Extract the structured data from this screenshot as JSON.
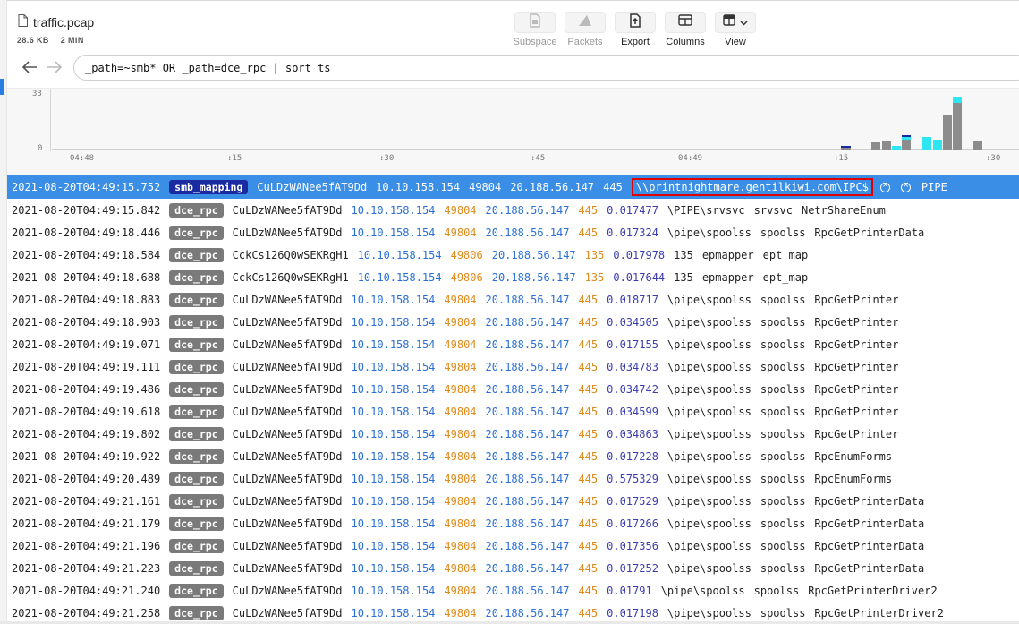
{
  "file": {
    "name": "traffic.pcap",
    "size": "28.6 KB",
    "duration": "2 MIN",
    "icon": "file-icon"
  },
  "toolbar": {
    "subspace": "Subspace",
    "packets": "Packets",
    "export": "Export",
    "columns": "Columns",
    "view": "View"
  },
  "query": "_path=~smb* OR _path=dce_rpc | sort ts",
  "histogram": {
    "y_labels": [
      "33",
      "0"
    ],
    "x_labels": [
      "04:48",
      ":15",
      ":30",
      ":45",
      "04:49",
      ":15",
      ":30"
    ],
    "colors": {
      "smb_mapping": "#1a2aa0",
      "dce_rpc": "#8c8c8c",
      "other": "#2ee6f0"
    }
  },
  "selected_row": {
    "ts": "2021-08-20T04:49:15.752",
    "path": "smb_mapping",
    "uid": "CuLDzWANee5fAT9Dd",
    "orig_h": "10.10.158.154",
    "orig_p": "49804",
    "resp_h": "20.188.56.147",
    "resp_p": "445",
    "share_path": "\\\\printnightmare.gentilkiwi.com\\IPC$",
    "service": "PIPE"
  },
  "rows": [
    {
      "ts": "2021-08-20T04:49:15.842",
      "path": "dce_rpc",
      "uid": "CuLDzWANee5fAT9Dd",
      "orig_h": "10.10.158.154",
      "orig_p": "49804",
      "resp_h": "20.188.56.147",
      "resp_p": "445",
      "rtt": "0.017477",
      "named_pipe": "\\PIPE\\srvsvc",
      "endpoint": "srvsvc",
      "operation": "NetrShareEnum"
    },
    {
      "ts": "2021-08-20T04:49:18.446",
      "path": "dce_rpc",
      "uid": "CuLDzWANee5fAT9Dd",
      "orig_h": "10.10.158.154",
      "orig_p": "49804",
      "resp_h": "20.188.56.147",
      "resp_p": "445",
      "rtt": "0.017324",
      "named_pipe": "\\pipe\\spoolss",
      "endpoint": "spoolss",
      "operation": "RpcGetPrinterData"
    },
    {
      "ts": "2021-08-20T04:49:18.584",
      "path": "dce_rpc",
      "uid": "CckCs126Q0wSEKRgH1",
      "orig_h": "10.10.158.154",
      "orig_p": "49806",
      "resp_h": "20.188.56.147",
      "resp_p": "135",
      "rtt": "0.017978",
      "named_pipe": "135",
      "endpoint": "epmapper",
      "operation": "ept_map"
    },
    {
      "ts": "2021-08-20T04:49:18.688",
      "path": "dce_rpc",
      "uid": "CckCs126Q0wSEKRgH1",
      "orig_h": "10.10.158.154",
      "orig_p": "49806",
      "resp_h": "20.188.56.147",
      "resp_p": "135",
      "rtt": "0.017644",
      "named_pipe": "135",
      "endpoint": "epmapper",
      "operation": "ept_map"
    },
    {
      "ts": "2021-08-20T04:49:18.883",
      "path": "dce_rpc",
      "uid": "CuLDzWANee5fAT9Dd",
      "orig_h": "10.10.158.154",
      "orig_p": "49804",
      "resp_h": "20.188.56.147",
      "resp_p": "445",
      "rtt": "0.018717",
      "named_pipe": "\\pipe\\spoolss",
      "endpoint": "spoolss",
      "operation": "RpcGetPrinter"
    },
    {
      "ts": "2021-08-20T04:49:18.903",
      "path": "dce_rpc",
      "uid": "CuLDzWANee5fAT9Dd",
      "orig_h": "10.10.158.154",
      "orig_p": "49804",
      "resp_h": "20.188.56.147",
      "resp_p": "445",
      "rtt": "0.034505",
      "named_pipe": "\\pipe\\spoolss",
      "endpoint": "spoolss",
      "operation": "RpcGetPrinter"
    },
    {
      "ts": "2021-08-20T04:49:19.071",
      "path": "dce_rpc",
      "uid": "CuLDzWANee5fAT9Dd",
      "orig_h": "10.10.158.154",
      "orig_p": "49804",
      "resp_h": "20.188.56.147",
      "resp_p": "445",
      "rtt": "0.017155",
      "named_pipe": "\\pipe\\spoolss",
      "endpoint": "spoolss",
      "operation": "RpcGetPrinter"
    },
    {
      "ts": "2021-08-20T04:49:19.111",
      "path": "dce_rpc",
      "uid": "CuLDzWANee5fAT9Dd",
      "orig_h": "10.10.158.154",
      "orig_p": "49804",
      "resp_h": "20.188.56.147",
      "resp_p": "445",
      "rtt": "0.034783",
      "named_pipe": "\\pipe\\spoolss",
      "endpoint": "spoolss",
      "operation": "RpcGetPrinter"
    },
    {
      "ts": "2021-08-20T04:49:19.486",
      "path": "dce_rpc",
      "uid": "CuLDzWANee5fAT9Dd",
      "orig_h": "10.10.158.154",
      "orig_p": "49804",
      "resp_h": "20.188.56.147",
      "resp_p": "445",
      "rtt": "0.034742",
      "named_pipe": "\\pipe\\spoolss",
      "endpoint": "spoolss",
      "operation": "RpcGetPrinter"
    },
    {
      "ts": "2021-08-20T04:49:19.618",
      "path": "dce_rpc",
      "uid": "CuLDzWANee5fAT9Dd",
      "orig_h": "10.10.158.154",
      "orig_p": "49804",
      "resp_h": "20.188.56.147",
      "resp_p": "445",
      "rtt": "0.034599",
      "named_pipe": "\\pipe\\spoolss",
      "endpoint": "spoolss",
      "operation": "RpcGetPrinter"
    },
    {
      "ts": "2021-08-20T04:49:19.802",
      "path": "dce_rpc",
      "uid": "CuLDzWANee5fAT9Dd",
      "orig_h": "10.10.158.154",
      "orig_p": "49804",
      "resp_h": "20.188.56.147",
      "resp_p": "445",
      "rtt": "0.034863",
      "named_pipe": "\\pipe\\spoolss",
      "endpoint": "spoolss",
      "operation": "RpcGetPrinter"
    },
    {
      "ts": "2021-08-20T04:49:19.922",
      "path": "dce_rpc",
      "uid": "CuLDzWANee5fAT9Dd",
      "orig_h": "10.10.158.154",
      "orig_p": "49804",
      "resp_h": "20.188.56.147",
      "resp_p": "445",
      "rtt": "0.017228",
      "named_pipe": "\\pipe\\spoolss",
      "endpoint": "spoolss",
      "operation": "RpcEnumForms"
    },
    {
      "ts": "2021-08-20T04:49:20.489",
      "path": "dce_rpc",
      "uid": "CuLDzWANee5fAT9Dd",
      "orig_h": "10.10.158.154",
      "orig_p": "49804",
      "resp_h": "20.188.56.147",
      "resp_p": "445",
      "rtt": "0.575329",
      "named_pipe": "\\pipe\\spoolss",
      "endpoint": "spoolss",
      "operation": "RpcEnumForms"
    },
    {
      "ts": "2021-08-20T04:49:21.161",
      "path": "dce_rpc",
      "uid": "CuLDzWANee5fAT9Dd",
      "orig_h": "10.10.158.154",
      "orig_p": "49804",
      "resp_h": "20.188.56.147",
      "resp_p": "445",
      "rtt": "0.017529",
      "named_pipe": "\\pipe\\spoolss",
      "endpoint": "spoolss",
      "operation": "RpcGetPrinterData"
    },
    {
      "ts": "2021-08-20T04:49:21.179",
      "path": "dce_rpc",
      "uid": "CuLDzWANee5fAT9Dd",
      "orig_h": "10.10.158.154",
      "orig_p": "49804",
      "resp_h": "20.188.56.147",
      "resp_p": "445",
      "rtt": "0.017266",
      "named_pipe": "\\pipe\\spoolss",
      "endpoint": "spoolss",
      "operation": "RpcGetPrinterData"
    },
    {
      "ts": "2021-08-20T04:49:21.196",
      "path": "dce_rpc",
      "uid": "CuLDzWANee5fAT9Dd",
      "orig_h": "10.10.158.154",
      "orig_p": "49804",
      "resp_h": "20.188.56.147",
      "resp_p": "445",
      "rtt": "0.017356",
      "named_pipe": "\\pipe\\spoolss",
      "endpoint": "spoolss",
      "operation": "RpcGetPrinterData"
    },
    {
      "ts": "2021-08-20T04:49:21.223",
      "path": "dce_rpc",
      "uid": "CuLDzWANee5fAT9Dd",
      "orig_h": "10.10.158.154",
      "orig_p": "49804",
      "resp_h": "20.188.56.147",
      "resp_p": "445",
      "rtt": "0.017252",
      "named_pipe": "\\pipe\\spoolss",
      "endpoint": "spoolss",
      "operation": "RpcGetPrinterData"
    },
    {
      "ts": "2021-08-20T04:49:21.240",
      "path": "dce_rpc",
      "uid": "CuLDzWANee5fAT9Dd",
      "orig_h": "10.10.158.154",
      "orig_p": "49804",
      "resp_h": "20.188.56.147",
      "resp_p": "445",
      "rtt": "0.01791",
      "named_pipe": "\\pipe\\spoolss",
      "endpoint": "spoolss",
      "operation": "RpcGetPrinterDriver2"
    },
    {
      "ts": "2021-08-20T04:49:21.258",
      "path": "dce_rpc",
      "uid": "CuLDzWANee5fAT9Dd",
      "orig_h": "10.10.158.154",
      "orig_p": "49804",
      "resp_h": "20.188.56.147",
      "resp_p": "445",
      "rtt": "0.017198",
      "named_pipe": "\\pipe\\spoolss",
      "endpoint": "spoolss",
      "operation": "RpcGetPrinterDriver2"
    }
  ]
}
